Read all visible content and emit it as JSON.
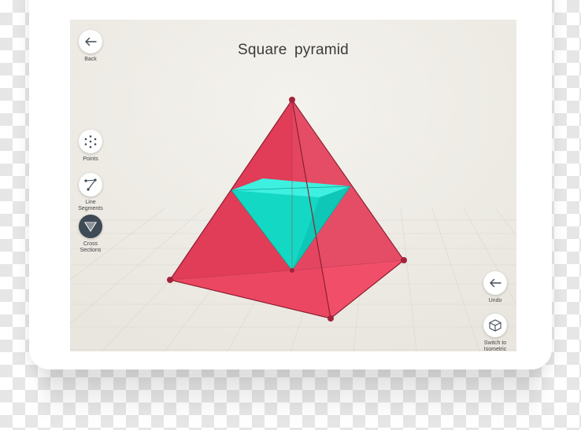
{
  "screen": {
    "title": "Square  pyramid",
    "colors": {
      "background": "#efece6",
      "pyramid": "#e8435f",
      "cross_section": "#1de3cf",
      "active_tool": "#3e4a55"
    }
  },
  "toolbar_left": {
    "back_label": "Back",
    "points_label": "Points",
    "line_segments_label": "Line Segments",
    "cross_sections_label": "Cross Sections"
  },
  "toolbar_right": {
    "undo_label": "Undo",
    "switch_label": "Switch to Isometric"
  },
  "icons": [
    "arrow-left-icon",
    "points-icon",
    "line-segment-icon",
    "cross-section-icon",
    "undo-icon",
    "cube-icon"
  ],
  "active_tool": "cross_sections"
}
